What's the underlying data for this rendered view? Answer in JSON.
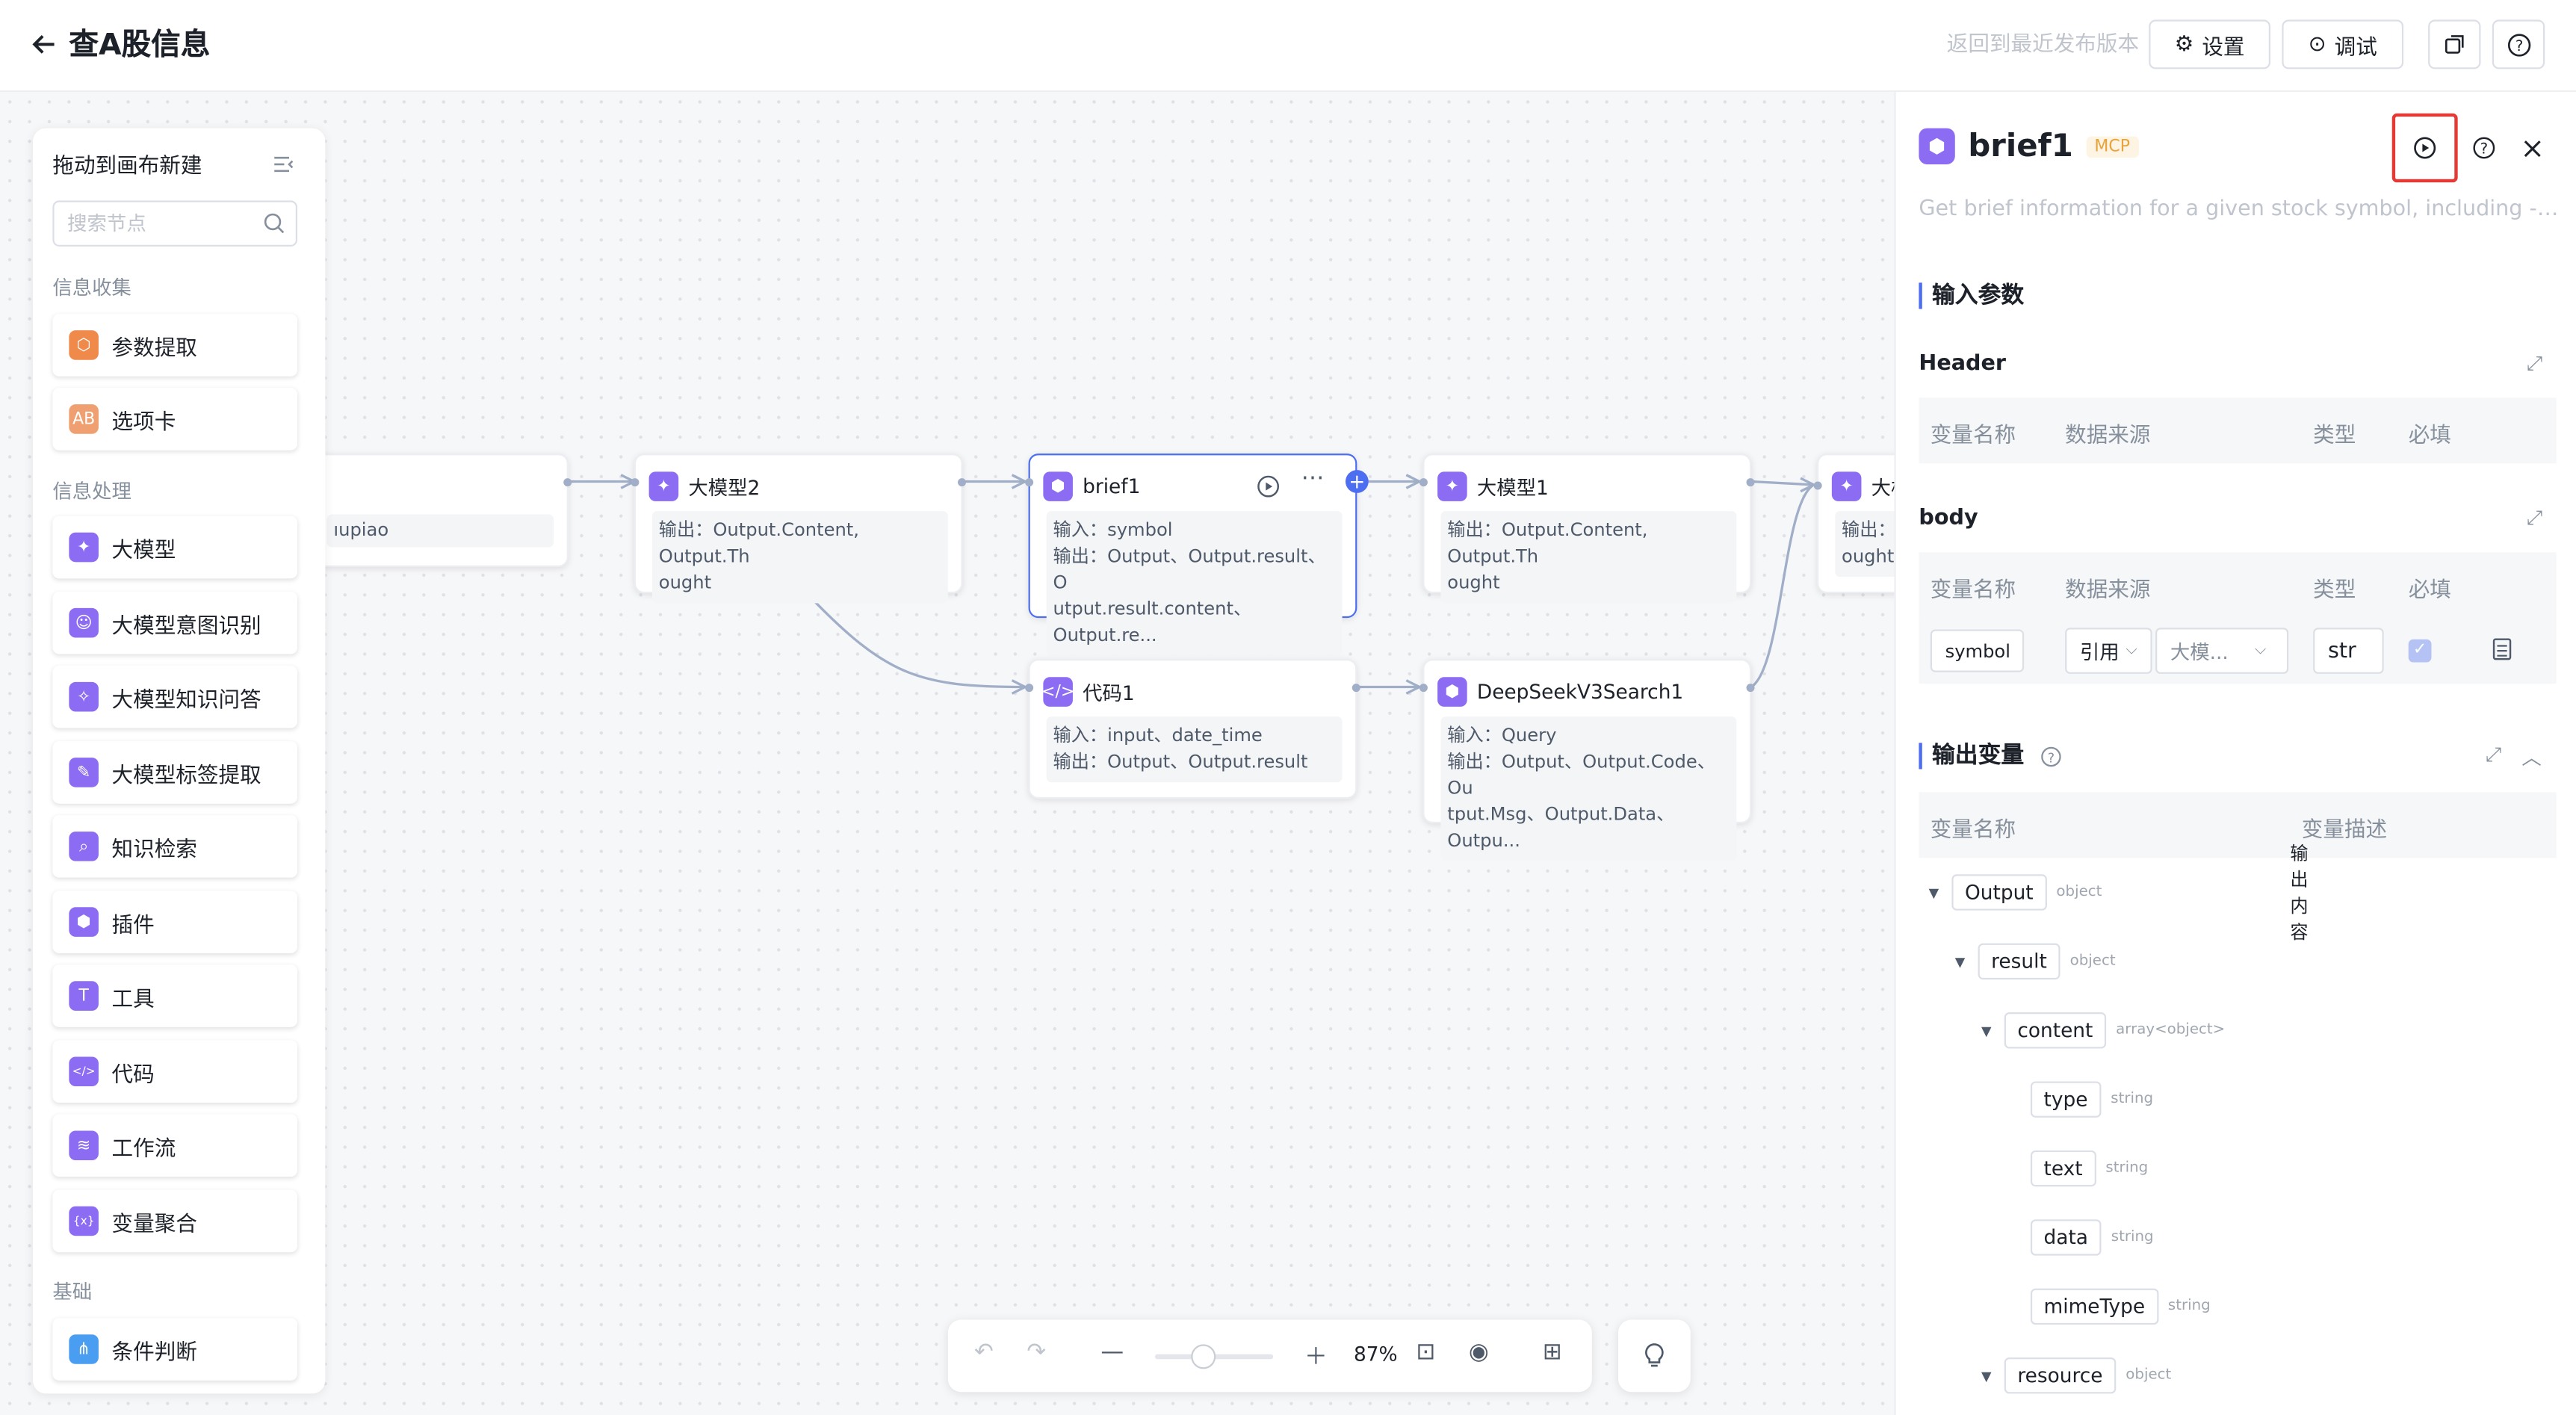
{
  "header": {
    "back_icon": "arrow-left-icon",
    "title": "查A股信息",
    "revert_label": "返回到最近发布版本",
    "settings_label": "设置",
    "debug_label": "调试"
  },
  "palette": {
    "title": "拖动到画布新建",
    "search_placeholder": "搜索节点",
    "sections": [
      "信息收集",
      "信息处理",
      "基础"
    ],
    "items": [
      {
        "label": "参数提取",
        "color": "#f08a4b"
      },
      {
        "label": "选项卡",
        "color": "#f0a070"
      },
      {
        "label": "大模型",
        "color": "#8c6cf2"
      },
      {
        "label": "大模型意图识别",
        "color": "#8c6cf2"
      },
      {
        "label": "大模型知识问答",
        "color": "#8c6cf2"
      },
      {
        "label": "大模型标签提取",
        "color": "#8c6cf2"
      },
      {
        "label": "知识检索",
        "color": "#8c6cf2"
      },
      {
        "label": "插件",
        "color": "#8c6cf2"
      },
      {
        "label": "工具",
        "color": "#8c6cf2"
      },
      {
        "label": "代码",
        "color": "#8c6cf2"
      },
      {
        "label": "工作流",
        "color": "#8c6cf2"
      },
      {
        "label": "变量聚合",
        "color": "#8c6cf2"
      },
      {
        "label": "条件判断",
        "color": "#4a9ef2"
      }
    ]
  },
  "nodes": {
    "left_partial": {
      "line1": "ıupiao"
    },
    "llm2": {
      "title": "大模型2",
      "line1": "输出：Output.Content, Output.Th",
      "line2": "ought"
    },
    "brief1": {
      "title": "brief1",
      "line1": "输入：symbol",
      "line2": "输出：Output、Output.result、O",
      "line3": "utput.result.content、Output.re..."
    },
    "llm1": {
      "title": "大模型1",
      "line1": "输出：Output.Content, Output.Th",
      "line2": "ought"
    },
    "right_partial": {
      "title": "大核",
      "line1": "输出：",
      "line2": "ought"
    },
    "code1": {
      "title": "代码1",
      "line1": "输入：input、date_time",
      "line2": "输出：Output、Output.result"
    },
    "deepseek": {
      "title": "DeepSeekV3Search1",
      "line1": "输入：Query",
      "line2": "输出：Output、Output.Code、Ou",
      "line3": "tput.Msg、Output.Data、Outpu..."
    }
  },
  "zoom": {
    "level": "87%"
  },
  "panel": {
    "name": "brief1",
    "badge": "MCP",
    "description": "Get brief information for a given stock symbol, including - basic ...",
    "input_title": "输入参数",
    "header_label": "Header",
    "body_label": "body",
    "columns": [
      "变量名称",
      "数据来源",
      "类型",
      "必填"
    ],
    "row": {
      "name": "symbol",
      "source_mode": "引用",
      "source_value": "大模...",
      "type": "str"
    },
    "output_title": "输出变量",
    "out_columns": [
      "变量名称",
      "变量描述"
    ],
    "tree": [
      {
        "name": "Output",
        "type": "object",
        "desc": "输出内容"
      },
      {
        "name": "result",
        "type": "object"
      },
      {
        "name": "content",
        "type": "array<object>"
      },
      {
        "name": "type",
        "type": "string"
      },
      {
        "name": "text",
        "type": "string"
      },
      {
        "name": "data",
        "type": "string"
      },
      {
        "name": "mimeType",
        "type": "string"
      },
      {
        "name": "resource",
        "type": "object"
      }
    ]
  }
}
